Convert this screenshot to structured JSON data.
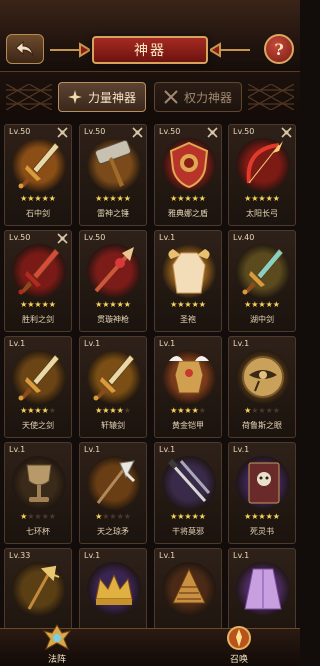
{
  "header": {
    "title": "神器",
    "help_label": "?"
  },
  "tabs": [
    {
      "label": "力量神器",
      "active": true
    },
    {
      "label": "权力神器",
      "active": false
    }
  ],
  "colors": {
    "gold_star": "#f7d35a",
    "title_red": "#8a1d16"
  },
  "artifacts": [
    {
      "name": "石中剑",
      "level": "Lv.50",
      "stars": 5,
      "locked": true,
      "tint": "#8a4e16",
      "icon": "sword-icon"
    },
    {
      "name": "雷神之锤",
      "level": "Lv.50",
      "stars": 5,
      "locked": true,
      "tint": "#7a4a1a",
      "icon": "hammer-icon"
    },
    {
      "name": "雅典娜之盾",
      "level": "Lv.50",
      "stars": 5,
      "locked": true,
      "tint": "#7e1c16",
      "icon": "shield-icon"
    },
    {
      "name": "太阳长弓",
      "level": "Lv.50",
      "stars": 5,
      "locked": true,
      "tint": "#7c1a14",
      "icon": "bow-icon"
    },
    {
      "name": "胜利之剑",
      "level": "Lv.50",
      "stars": 5,
      "locked": true,
      "tint": "#7a1a16",
      "icon": "red-sword-icon"
    },
    {
      "name": "贯璇神枪",
      "level": "Lv.50",
      "stars": 5,
      "locked": false,
      "tint": "#7c1c18",
      "icon": "spear-icon"
    },
    {
      "name": "圣袍",
      "level": "Lv.1",
      "stars": 5,
      "locked": false,
      "tint": "#8a5a1e",
      "icon": "robe-icon"
    },
    {
      "name": "湖中剑",
      "level": "Lv.40",
      "stars": 5,
      "locked": false,
      "tint": "#5a4a1e",
      "icon": "lake-sword-icon"
    },
    {
      "name": "天使之剑",
      "level": "Lv.1",
      "stars": 4,
      "locked": false,
      "tint": "#6a4414",
      "icon": "angel-sword-icon"
    },
    {
      "name": "轩辕剑",
      "level": "Lv.1",
      "stars": 4,
      "locked": false,
      "tint": "#7a4e14",
      "icon": "xuanyuan-sword-icon"
    },
    {
      "name": "黄金铠甲",
      "level": "Lv.1",
      "stars": 4,
      "locked": false,
      "tint": "#7a3a1a",
      "icon": "armor-icon"
    },
    {
      "name": "荷鲁斯之眼",
      "level": "Lv.1",
      "stars": 1,
      "locked": false,
      "tint": "#5a3e1a",
      "icon": "eye-of-horus-icon"
    },
    {
      "name": "七环杯",
      "level": "Lv.1",
      "stars": 1,
      "locked": false,
      "tint": "#3a2a1a",
      "icon": "cup-icon"
    },
    {
      "name": "天之琼矛",
      "level": "Lv.1",
      "stars": 1,
      "locked": false,
      "tint": "#6a3e14",
      "icon": "halberd-icon"
    },
    {
      "name": "干将莫邪",
      "level": "Lv.1",
      "stars": 5,
      "locked": false,
      "tint": "#3a2a4a",
      "icon": "twin-swords-icon"
    },
    {
      "name": "死灵书",
      "level": "Lv.1",
      "stars": 5,
      "locked": false,
      "tint": "#3a2450",
      "icon": "necro-book-icon"
    },
    {
      "name": "",
      "level": "Lv.33",
      "stars": 0,
      "locked": false,
      "tint": "#5a3e14",
      "icon": "trident-icon"
    },
    {
      "name": "",
      "level": "Lv.1",
      "stars": 0,
      "locked": false,
      "tint": "#3a2450",
      "icon": "crown-icon"
    },
    {
      "name": "",
      "level": "Lv.1",
      "stars": 0,
      "locked": false,
      "tint": "#4a2a16",
      "icon": "harp-icon"
    },
    {
      "name": "",
      "level": "Lv.1",
      "stars": 0,
      "locked": false,
      "tint": "#4a2a5a",
      "icon": "cape-icon"
    }
  ],
  "footer": {
    "left_label": "法阵",
    "right_label": "召唤"
  }
}
